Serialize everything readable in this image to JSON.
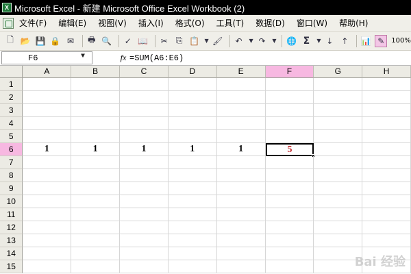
{
  "window": {
    "title": "Microsoft Excel - 新建 Microsoft Office Excel Workbook (2)"
  },
  "menu": [
    "文件(F)",
    "编辑(E)",
    "视图(V)",
    "插入(I)",
    "格式(O)",
    "工具(T)",
    "数据(D)",
    "窗口(W)",
    "帮助(H)"
  ],
  "toolbar": {
    "zoom": "100%",
    "sigma": "Σ"
  },
  "formula_bar": {
    "name_box": "F6",
    "fx_label": "fx",
    "formula": "=SUM(A6:E6)"
  },
  "columns": [
    "A",
    "B",
    "C",
    "D",
    "E",
    "F",
    "G",
    "H"
  ],
  "rows": [
    "1",
    "2",
    "3",
    "4",
    "5",
    "6",
    "7",
    "8",
    "9",
    "10",
    "11",
    "12",
    "13",
    "14",
    "15"
  ],
  "active_cell": {
    "row": "6",
    "col": "F"
  },
  "cells": {
    "A6": "1",
    "B6": "1",
    "C6": "1",
    "D6": "1",
    "E6": "1",
    "F6": "5"
  },
  "watermark": "Bai 经验",
  "colors": {
    "selected_header": "#f7b8e1",
    "result_text": "#c0282c"
  }
}
